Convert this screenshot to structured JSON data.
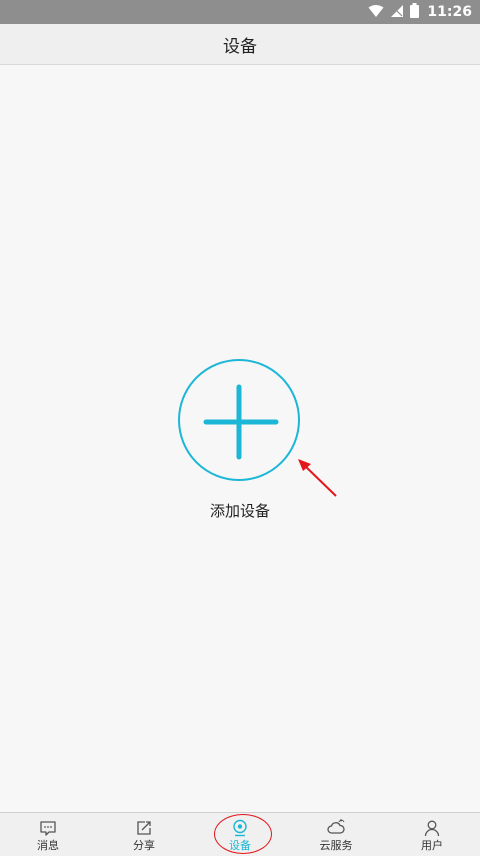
{
  "status_bar": {
    "time": "11:26",
    "icons": [
      "wifi-icon",
      "signal-icon",
      "battery-icon"
    ],
    "background": "#8e8e8e"
  },
  "header": {
    "title": "设备"
  },
  "main": {
    "add_device_label": "添加设备",
    "accent_color": "#1cb6d6",
    "annotation_arrow_color": "#e4161b"
  },
  "tab_bar": {
    "active_tab": "设备",
    "items": [
      {
        "label": "消息",
        "icon": "message-icon"
      },
      {
        "label": "分享",
        "icon": "share-icon"
      },
      {
        "label": "设备",
        "icon": "camera-icon"
      },
      {
        "label": "云服务",
        "icon": "cloud-icon"
      },
      {
        "label": "用户",
        "icon": "user-icon"
      }
    ]
  }
}
